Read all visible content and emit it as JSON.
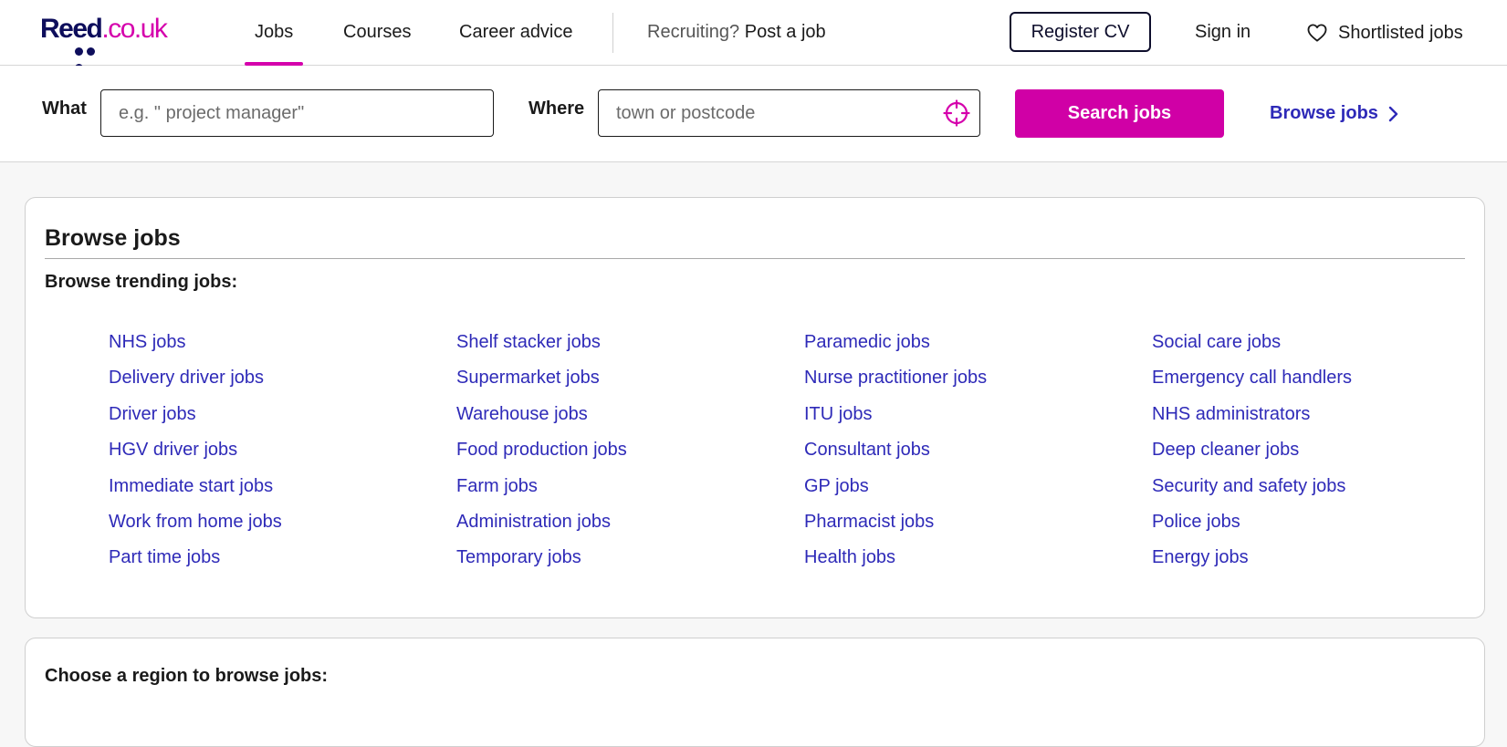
{
  "brand": {
    "logo_primary": "Reed",
    "logo_secondary": ".co.uk",
    "colors": {
      "navy": "#0e0e5c",
      "magenta": "#d500ac",
      "link": "#2e2ab8"
    }
  },
  "nav": {
    "jobs": "Jobs",
    "courses": "Courses",
    "career_advice": "Career advice",
    "recruiting_prefix": "Recruiting?",
    "post_job": "Post a job",
    "register_cv": "Register CV",
    "sign_in": "Sign in",
    "shortlisted": "Shortlisted jobs",
    "shortlist_icon": "heart-icon"
  },
  "search": {
    "what_label": "What",
    "what_placeholder": "e.g. \" project manager\"",
    "what_value": "",
    "where_label": "Where",
    "where_placeholder": "town or postcode",
    "where_value": "",
    "locate_icon": "crosshair-icon",
    "search_button": "Search jobs",
    "browse_link": "Browse jobs",
    "browse_icon": "chevron-right-icon"
  },
  "browse": {
    "title": "Browse jobs",
    "trending_heading": "Browse trending jobs:",
    "columns": [
      [
        "NHS jobs",
        "Delivery driver jobs",
        "Driver jobs",
        "HGV driver jobs",
        "Immediate start jobs",
        "Work from home jobs",
        "Part time jobs"
      ],
      [
        "Shelf stacker jobs",
        "Supermarket jobs",
        "Warehouse jobs",
        "Food production jobs",
        "Farm jobs",
        "Administration jobs",
        "Temporary jobs"
      ],
      [
        "Paramedic jobs",
        "Nurse practitioner jobs",
        "ITU jobs",
        "Consultant jobs",
        "GP jobs",
        "Pharmacist jobs",
        "Health jobs"
      ],
      [
        "Social care jobs",
        "Emergency call handlers",
        "NHS administrators",
        "Deep cleaner jobs",
        "Security and safety jobs",
        "Police jobs",
        "Energy jobs"
      ]
    ]
  },
  "regions": {
    "heading": "Choose a region to browse jobs:"
  }
}
